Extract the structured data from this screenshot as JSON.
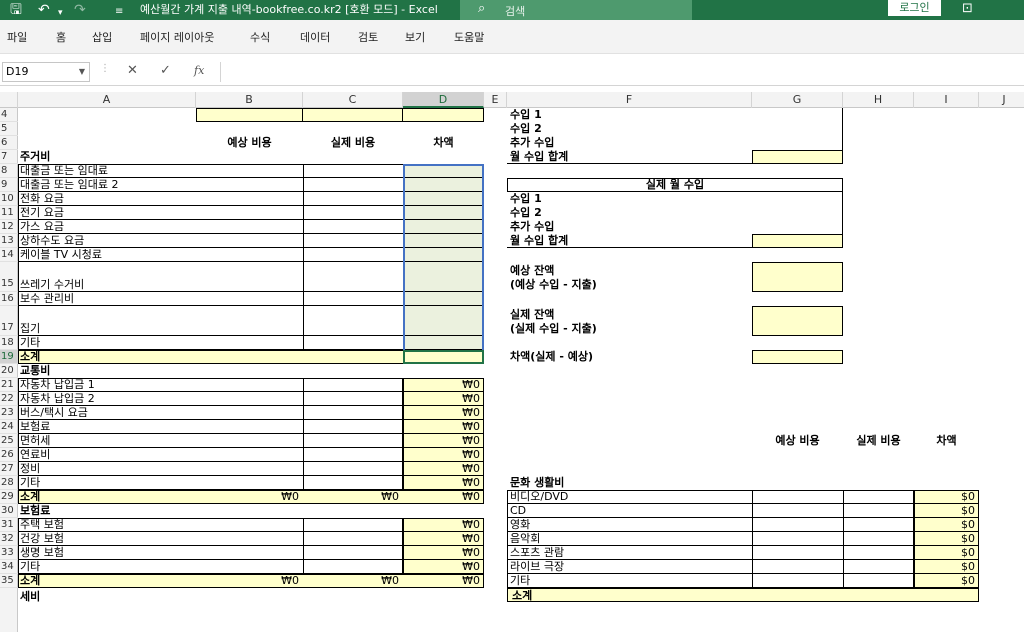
{
  "titlebar": {
    "title": "예산월간 가계 지출 내역-bookfree.co.kr2  [호환 모드]  -  Excel",
    "search": "검색",
    "login": "로그인"
  },
  "menu": [
    "파일",
    "홈",
    "삽입",
    "페이지 레이아웃",
    "수식",
    "데이터",
    "검토",
    "보기",
    "도움말"
  ],
  "formulabar": {
    "cell_ref": "D19",
    "cancel": "✕",
    "enter": "✓",
    "fx": "fx",
    "value": ""
  },
  "columns": [
    "A",
    "B",
    "C",
    "D",
    "E",
    "F",
    "G",
    "H",
    "I",
    "J"
  ],
  "rows": [
    "4",
    "5",
    "6",
    "7",
    "8",
    "9",
    "10",
    "11",
    "12",
    "13",
    "14",
    "15",
    "16",
    "17",
    "18",
    "19",
    "20",
    "21",
    "22",
    "23",
    "24",
    "25",
    "26",
    "27",
    "28",
    "29",
    "30",
    "31",
    "32",
    "33",
    "34",
    "35"
  ],
  "selected": {
    "cell": "D19",
    "column": "D",
    "row": "19"
  },
  "left": {
    "headers": {
      "budget": "예상 비용",
      "actual": "실제 비용",
      "diff": "차액"
    },
    "housing_title": "주거비",
    "housing_items": [
      "대출금 또는 임대료",
      "대출금 또는 임대료 2",
      "전화 요금",
      "전기 요금",
      "가스 요금",
      "상하수도 요금",
      "케이블 TV 시청료",
      "쓰레기 수거비",
      "보수 관리비",
      "집기",
      "기타"
    ],
    "subtotal": "소계",
    "transport_title": "교통비",
    "transport_items": [
      "자동차 납입금 1",
      "자동차 납입금 2",
      "버스/택시 요금",
      "보험료",
      "면허세",
      "연료비",
      "정비",
      "기타"
    ],
    "insurance_title": "보험료",
    "insurance_items": [
      "주택 보험",
      "건강 보험",
      "생명 보험",
      "기타"
    ],
    "won_zero": "₩0",
    "cut_label": "세비"
  },
  "right": {
    "income_items": [
      "수입 1",
      "수입 2",
      "추가 수입",
      "월 수입 합계"
    ],
    "actual_income_title": "실제 월 수입",
    "actual_items": [
      "수입 1",
      "수입 2",
      "추가 수입",
      "월 수입 합계"
    ],
    "est_balance": "예상 잔액",
    "est_balance_sub": "(예상 수입 - 지출)",
    "act_balance": "실제 잔액",
    "act_balance_sub": "(실제 수입 - 지출)",
    "diff_label": "차액(실제 - 예상)",
    "headers": {
      "budget": "예상 비용",
      "actual": "실제 비용",
      "diff": "차액"
    },
    "culture_title": "문화 생활비",
    "culture_items": [
      "비디오/DVD",
      "CD",
      "영화",
      "음악회",
      "스포츠 관람",
      "라이브 극장",
      "기타"
    ],
    "dollar_zero": "$0",
    "cut_subtotal": "소계"
  }
}
